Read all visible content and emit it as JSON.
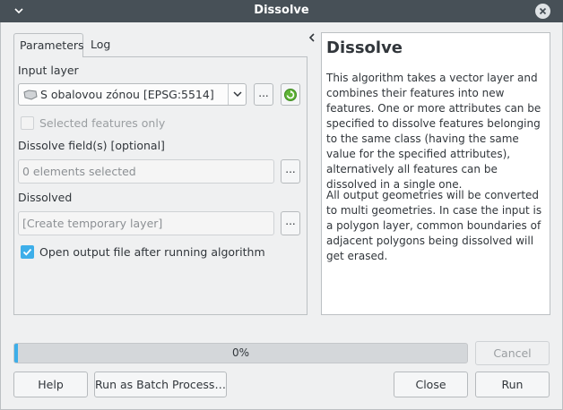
{
  "window": {
    "title": "Dissolve"
  },
  "tabs": [
    {
      "label": "Parameters",
      "active": true
    },
    {
      "label": "Log",
      "active": false
    }
  ],
  "parameters": {
    "input_layer": {
      "label": "Input layer",
      "value": "S obalovou zónou [EPSG:5514]",
      "browse_label": "...",
      "icon": "polygon-layer-icon"
    },
    "selected_only": {
      "label": "Selected features only",
      "checked": false,
      "enabled": false
    },
    "dissolve_fields": {
      "label": "Dissolve field(s) [optional]",
      "value": "0 elements selected",
      "browse_label": "..."
    },
    "dissolved": {
      "label": "Dissolved",
      "placeholder": "[Create temporary layer]",
      "browse_label": "..."
    },
    "open_output": {
      "label": "Open output file after running algorithm",
      "checked": true
    }
  },
  "help": {
    "title": "Dissolve",
    "paragraphs": [
      "This algorithm takes a vector layer and combines their features into new features. One or more attributes can be specified to dissolve features belonging to the same class (having the same value for the specified attributes), alternatively all features can be dissolved in a single one.",
      "All output geometries will be converted to multi geometries. In case the input is a polygon layer, common boundaries of adjacent polygons being dissolved will get erased."
    ]
  },
  "progress": {
    "text": "0%",
    "value": 0
  },
  "buttons": {
    "cancel": "Cancel",
    "help": "Help",
    "batch": "Run as Batch Process…",
    "close": "Close",
    "run": "Run"
  },
  "colors": {
    "titlebar": "#475057",
    "accent": "#3daee9",
    "background": "#eff0f1"
  }
}
